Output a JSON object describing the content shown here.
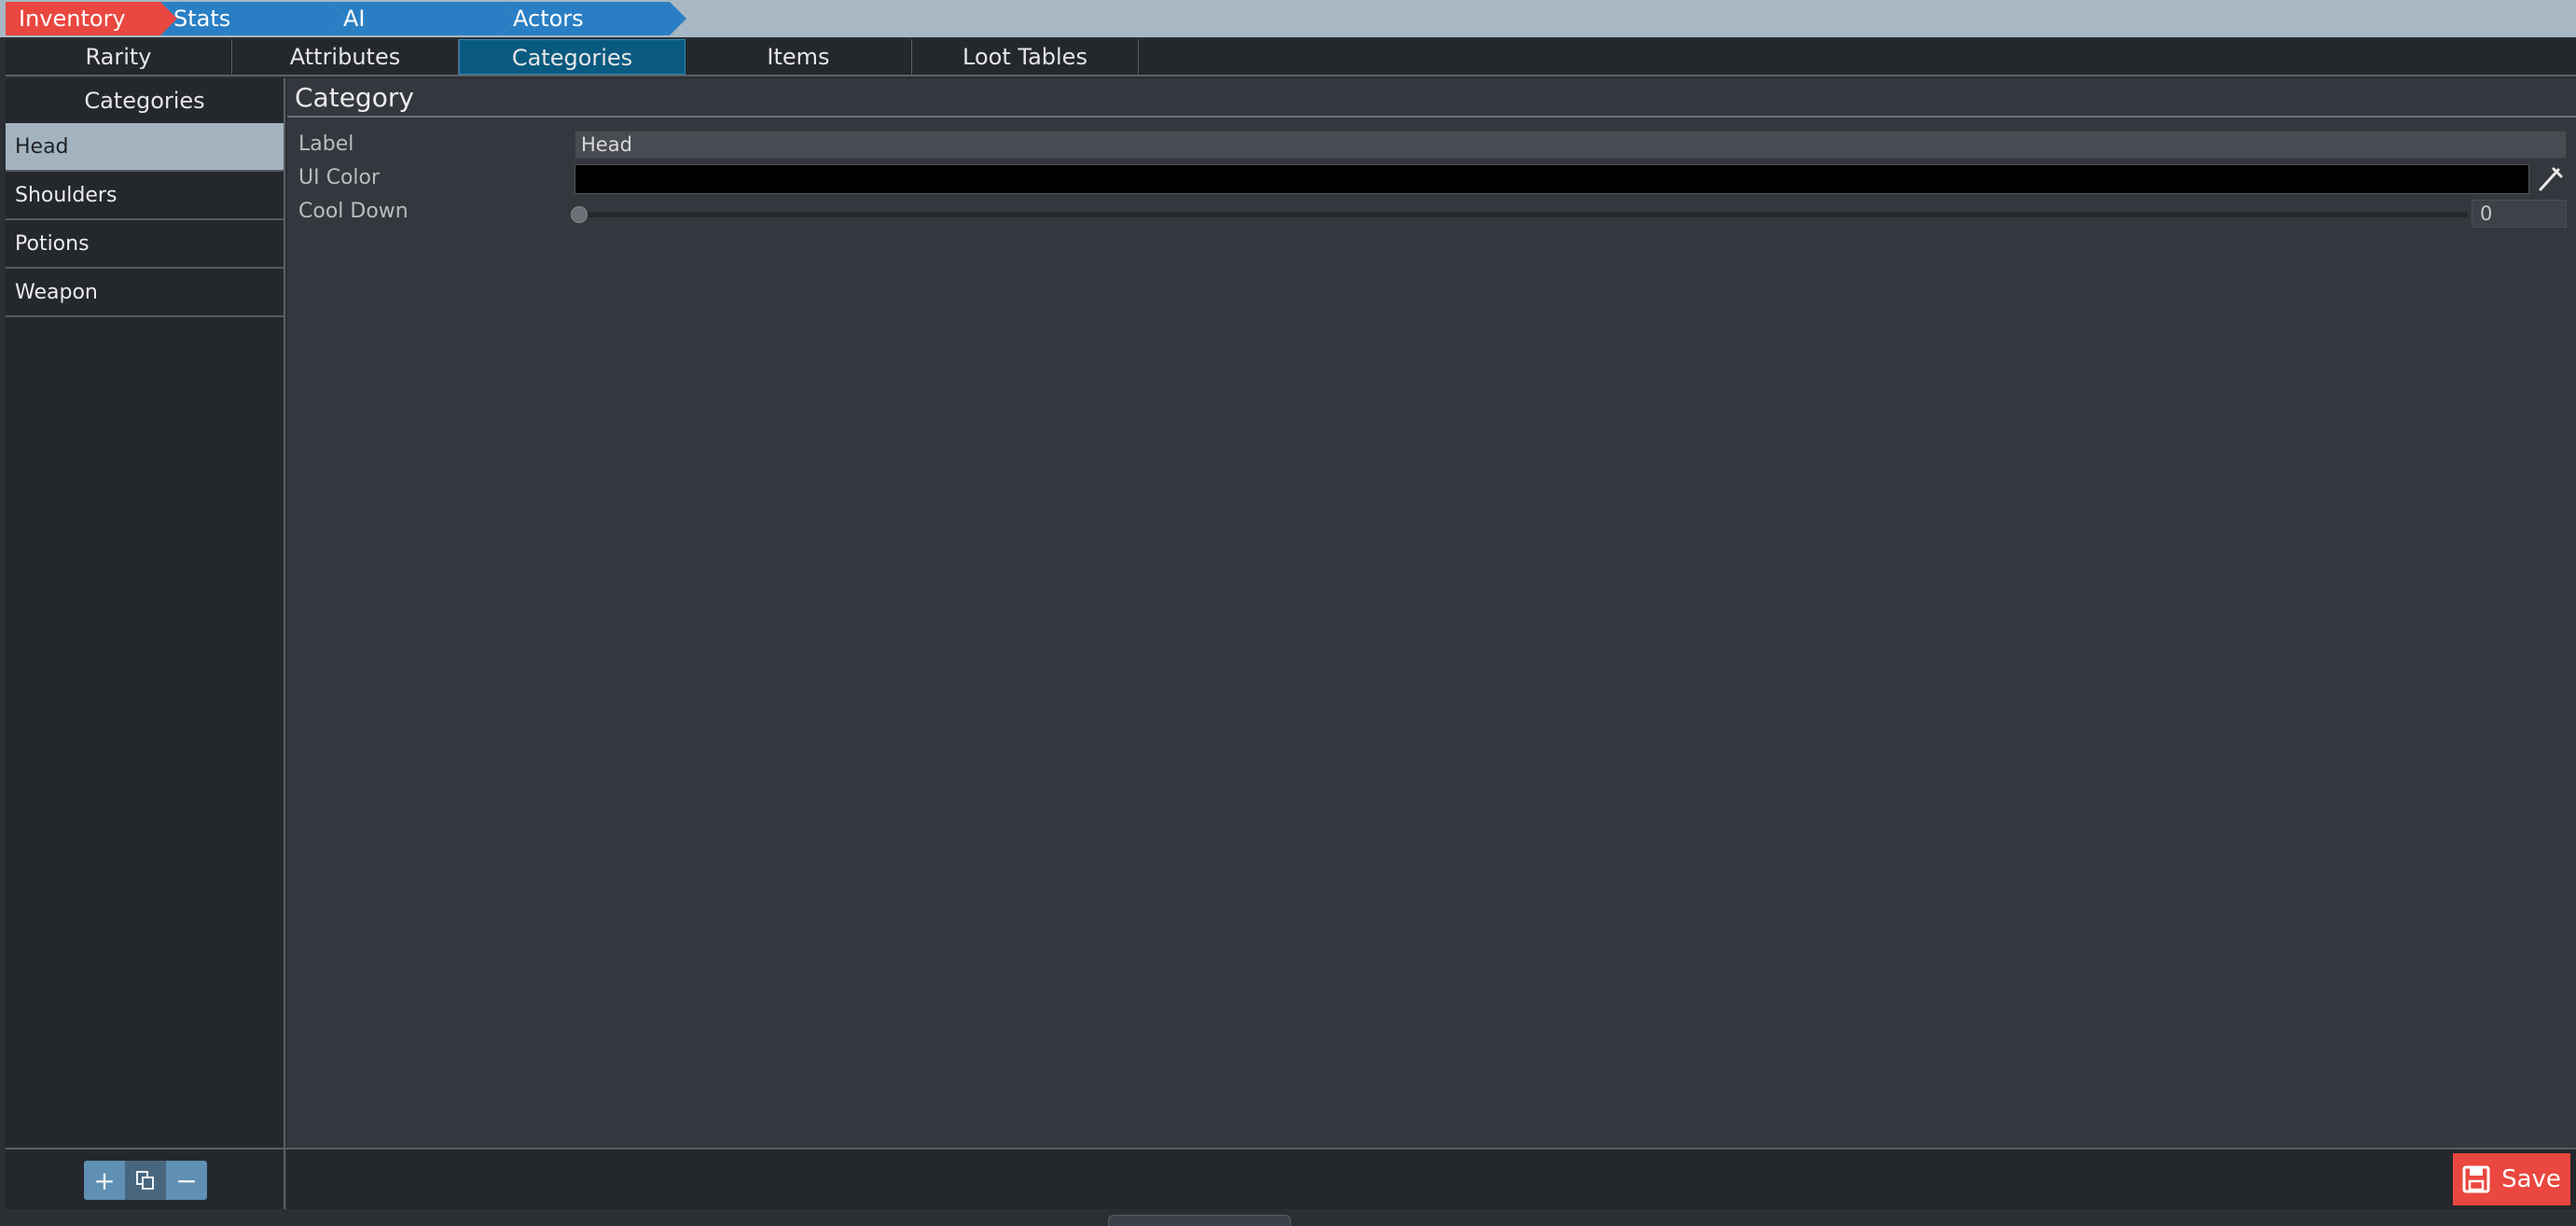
{
  "breadcrumbs": [
    {
      "label": "Inventory",
      "active": true
    },
    {
      "label": "Stats",
      "active": false
    },
    {
      "label": "AI",
      "active": false
    },
    {
      "label": "Actors",
      "active": false
    }
  ],
  "tabs": [
    {
      "label": "Rarity"
    },
    {
      "label": "Attributes"
    },
    {
      "label": "Categories",
      "selected": true
    },
    {
      "label": "Items"
    },
    {
      "label": "Loot Tables"
    }
  ],
  "list": {
    "header": "Categories",
    "items": [
      "Head",
      "Shoulders",
      "Potions",
      "Weapon"
    ],
    "selected": "Head"
  },
  "detail": {
    "title": "Category",
    "fields": {
      "label_name": "Label",
      "label_value": "Head",
      "ui_color_name": "UI Color",
      "ui_color_value": "#000000",
      "cooldown_name": "Cool Down",
      "cooldown_value": "0",
      "cooldown_fraction": 0
    }
  },
  "bottom": {
    "add_glyph": "+",
    "duplicate_icon": "duplicate-icon",
    "remove_glyph": "−",
    "save_label": "Save",
    "save_icon": "floppy-disk-icon"
  },
  "colors": {
    "accent_red": "#e9473f",
    "crumb_blue": "#2a7fc4",
    "tab_selected": "#0a5a80",
    "list_selected": "#a3b4c0"
  }
}
